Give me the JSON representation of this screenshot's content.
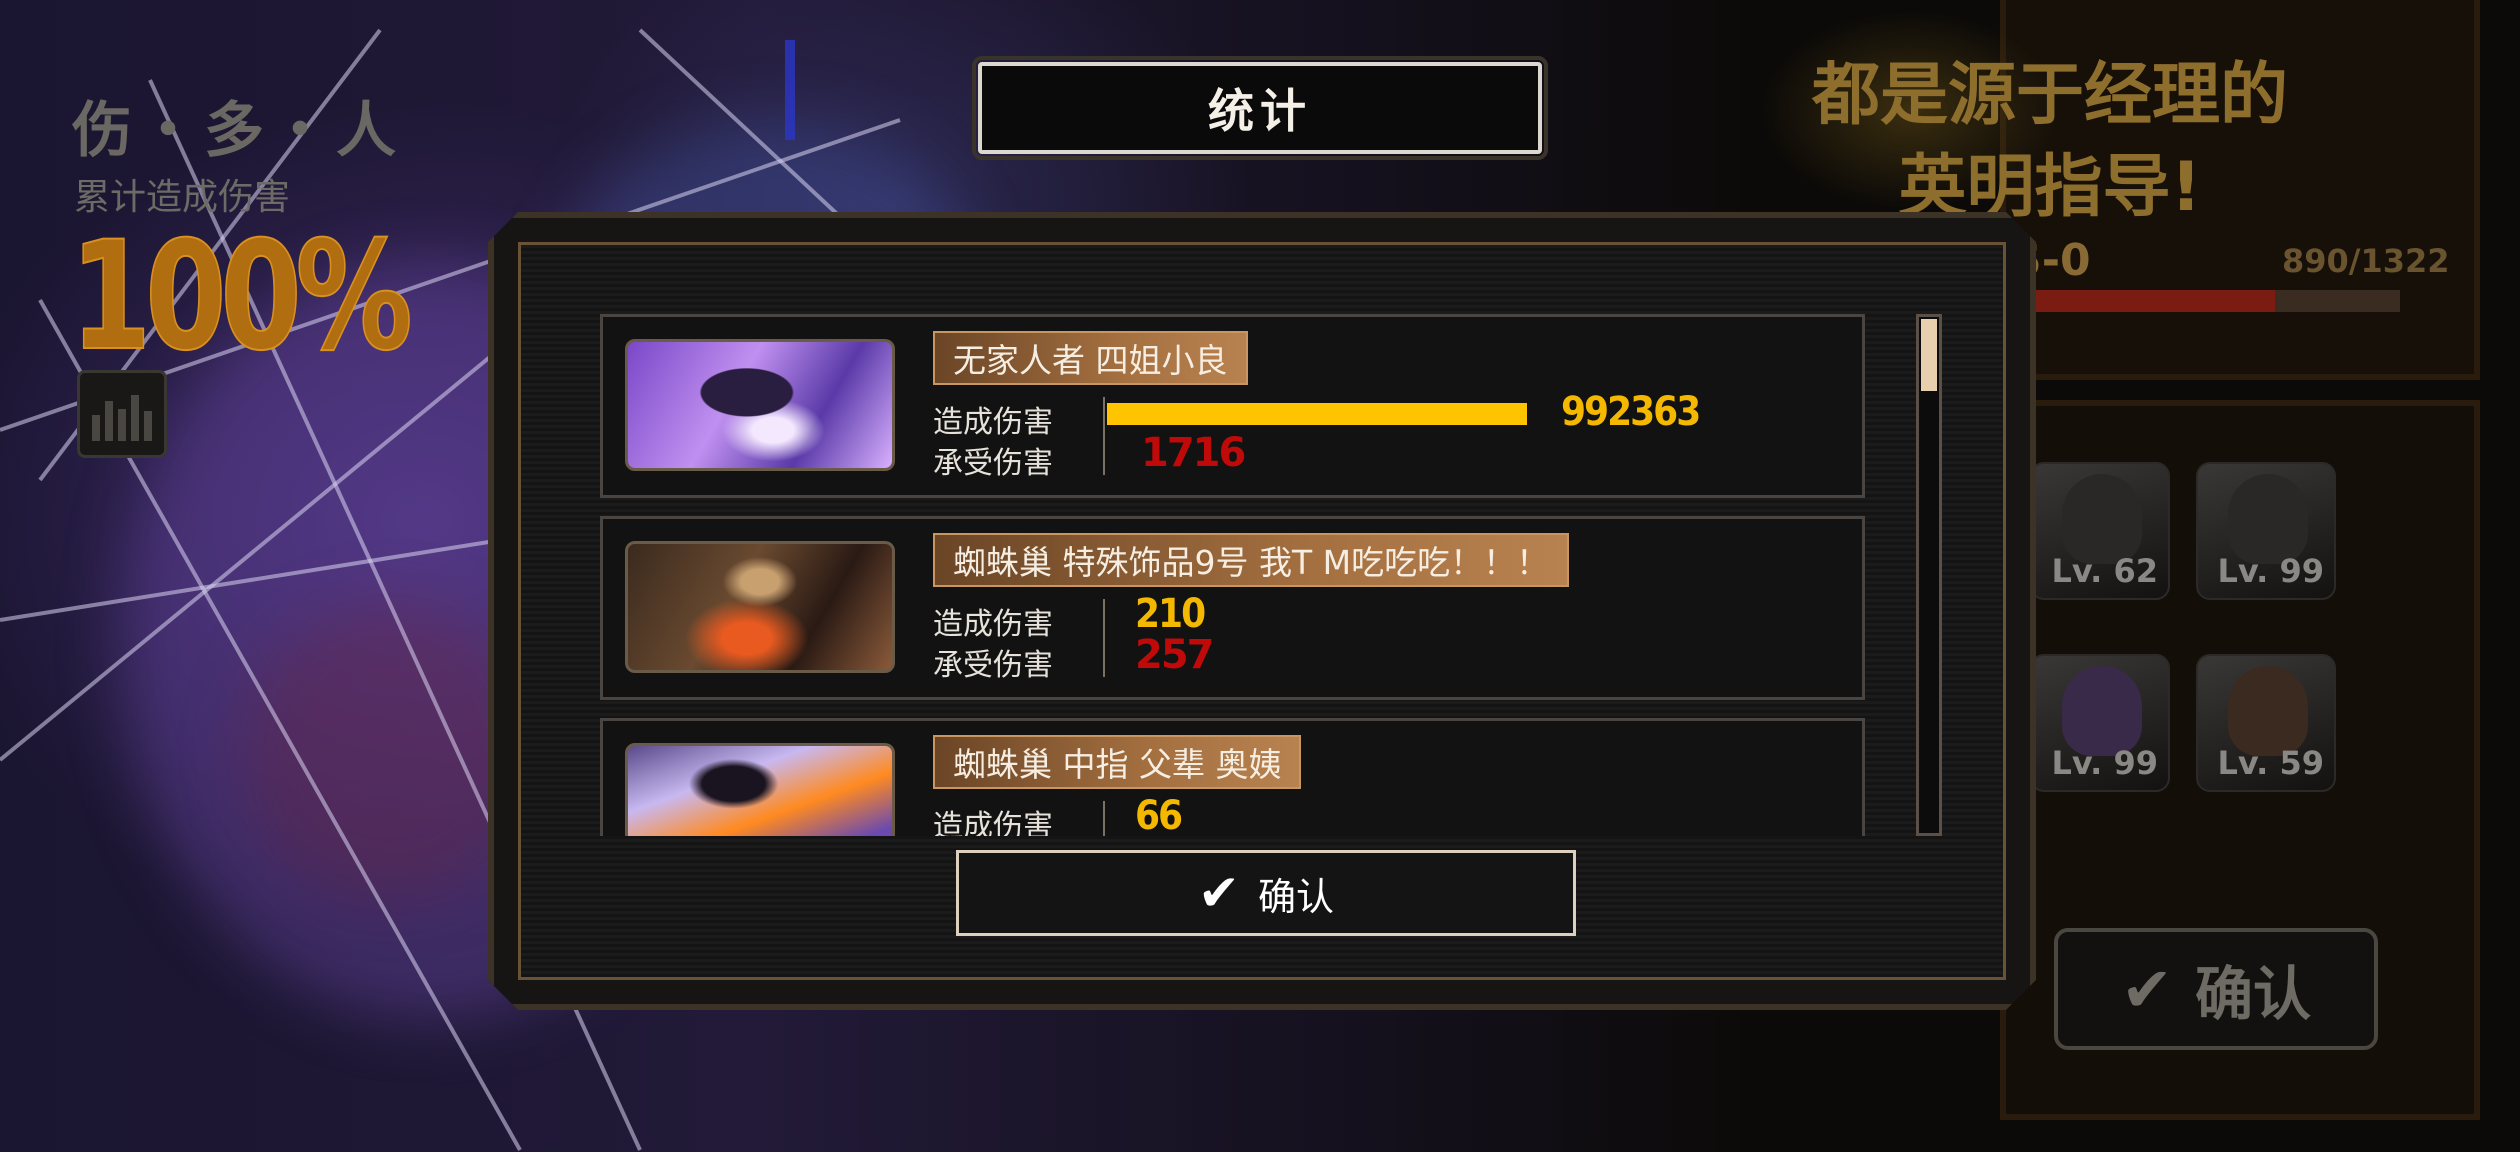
{
  "hud": {
    "title": "伤・多・人",
    "subtitle": "累计造成伤害",
    "percent": "100%",
    "stats_icon": "bar-chart-icon"
  },
  "background": {
    "quote_line1": "都是源于经理的",
    "quote_line2": "英明指导!",
    "rank": "S-0",
    "exp": "890/1322",
    "exp_fraction": 0.673,
    "levels": [
      "Lv. 62",
      "Lv. 99",
      "Lv. 99",
      "Lv. 59"
    ],
    "confirm_label": "确认"
  },
  "dialog": {
    "title": "统计",
    "confirm_label": "确认",
    "confirm_icon": "checkmark-icon",
    "dealt_label": "造成伤害",
    "taken_label": "承受伤害",
    "entries": [
      {
        "name": "无家人者 四姐小良",
        "damage_dealt": "992363",
        "damage_taken": "1716",
        "dealt_fraction": 1.0
      },
      {
        "name": "蜘蛛巢 特殊饰品9号 我T M吃吃吃！！！",
        "damage_dealt": "210",
        "damage_taken": "257",
        "dealt_fraction": 0.0002
      },
      {
        "name": "蜘蛛巢 中指 父辈 奥姨",
        "damage_dealt": "66",
        "damage_taken": "",
        "dealt_fraction": 0.0001
      }
    ]
  },
  "colors": {
    "dealt": "#ffc400",
    "taken": "#c00a0a",
    "accent_gold": "#a57040"
  }
}
